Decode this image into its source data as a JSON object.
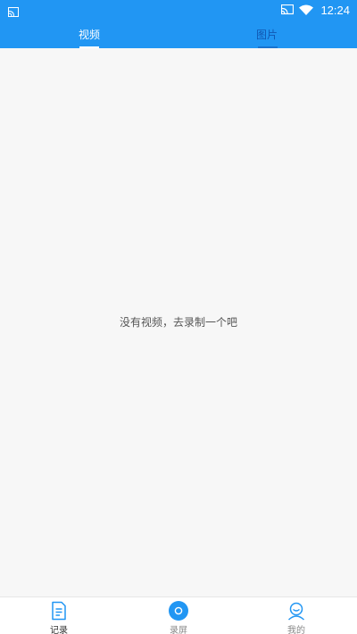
{
  "status_bar": {
    "time": "12:24"
  },
  "tabs": [
    {
      "label": "视频",
      "active": true
    },
    {
      "label": "图片",
      "active": false
    }
  ],
  "empty_message": "没有视频，去录制一个吧",
  "bottom_nav": {
    "records_label": "记录",
    "screen_label": "录屏",
    "mine_label": "我的"
  },
  "colors": {
    "accent": "#2196f3",
    "background": "#f7f7f7"
  },
  "icons": {
    "cast": "cast-icon",
    "wifi": "wifi-icon",
    "document": "document-icon",
    "record": "record-icon",
    "user": "user-icon"
  }
}
